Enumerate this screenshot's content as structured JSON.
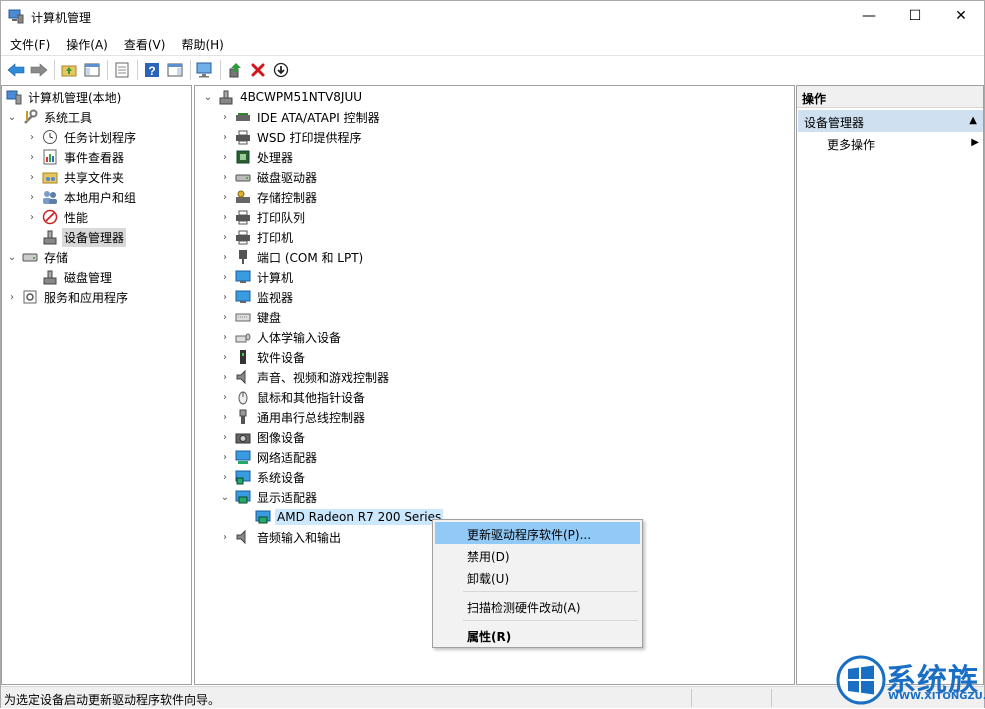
{
  "window": {
    "title": "计算机管理",
    "controls": {
      "minimize": "—",
      "maximize": "☐",
      "close": "✕"
    }
  },
  "menubar": [
    "文件(F)",
    "操作(A)",
    "查看(V)",
    "帮助(H)"
  ],
  "left_tree": {
    "root": "计算机管理(本地)",
    "system_tools": "系统工具",
    "system_tools_children": [
      "任务计划程序",
      "事件查看器",
      "共享文件夹",
      "本地用户和组",
      "性能",
      "设备管理器"
    ],
    "storage": "存储",
    "storage_children": [
      "磁盘管理"
    ],
    "services": "服务和应用程序"
  },
  "device_tree": {
    "computer_name": "4BCWPM51NTV8JUU",
    "categories": [
      "IDE ATA/ATAPI 控制器",
      "WSD 打印提供程序",
      "处理器",
      "磁盘驱动器",
      "存储控制器",
      "打印队列",
      "打印机",
      "端口 (COM 和 LPT)",
      "计算机",
      "监视器",
      "键盘",
      "人体学输入设备",
      "软件设备",
      "声音、视频和游戏控制器",
      "鼠标和其他指针设备",
      "通用串行总线控制器",
      "图像设备",
      "网络适配器",
      "系统设备",
      "显示适配器"
    ],
    "display_adapter_child": "AMD Radeon R7 200 Series",
    "audio_io": "音频输入和输出"
  },
  "actions": {
    "header": "操作",
    "section": "设备管理器",
    "more": "更多操作"
  },
  "context_menu": {
    "update_driver": "更新驱动程序软件(P)...",
    "disable": "禁用(D)",
    "uninstall": "卸载(U)",
    "scan": "扫描检测硬件改动(A)",
    "properties": "属性(R)"
  },
  "status_bar": "为选定设备启动更新驱动程序软件向导。",
  "watermark": {
    "text": "系统族",
    "url": "WWW.XITONGZU.COM"
  },
  "colors": {
    "selection": "#cce8ff",
    "menu_hover": "#91c9f7",
    "action_section": "#cfe0f1",
    "brand_blue": "#1a6fc4"
  }
}
